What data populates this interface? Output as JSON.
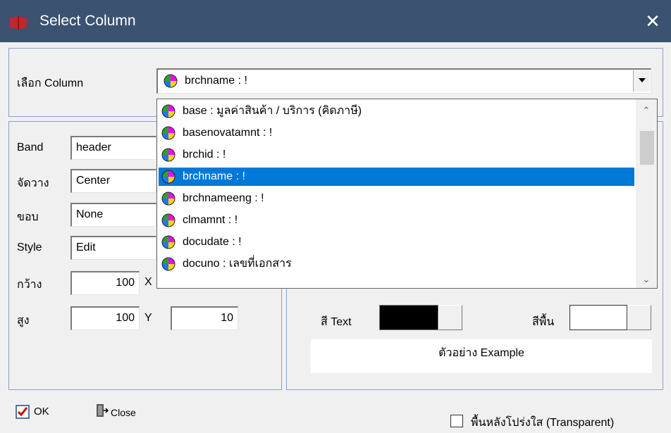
{
  "window": {
    "title": "Select Column",
    "close_symbol": "✕"
  },
  "column_select": {
    "label": "เลือก Column",
    "value": "brchname : !"
  },
  "dropdown": {
    "items": [
      "base : มูลค่าสินค้า / บริการ (คิดภาษี)",
      "basenovatamnt : !",
      "brchid : !",
      "brchname : !",
      "brchnameeng : !",
      "clmamnt : !",
      "docudate : !",
      "docuno : เลขที่เอกสาร"
    ],
    "selected_index": 3
  },
  "props": {
    "band_label": "Band",
    "band_value": "header",
    "align_label": "จัดวาง",
    "align_value": "Center",
    "border_label": "ขอบ",
    "border_value": "None",
    "style_label": "Style",
    "style_value": "Edit",
    "width_label": "กว้าง",
    "width_value": "100",
    "x_label": "X",
    "height_label": "สูง",
    "height_value": "100",
    "y_label": "Y",
    "y_value": "10"
  },
  "colors": {
    "text_label": "สี Text",
    "text_color": "#000000",
    "bg_label": "สีพื้น",
    "bg_color": "#ffffff",
    "example": "ตัวอย่าง Example"
  },
  "footer": {
    "ok_label": "OK",
    "close_label": "Close",
    "transparent_label": "พื้นหลังโปร่งใส (Transparent)",
    "transparent_checked": false
  }
}
